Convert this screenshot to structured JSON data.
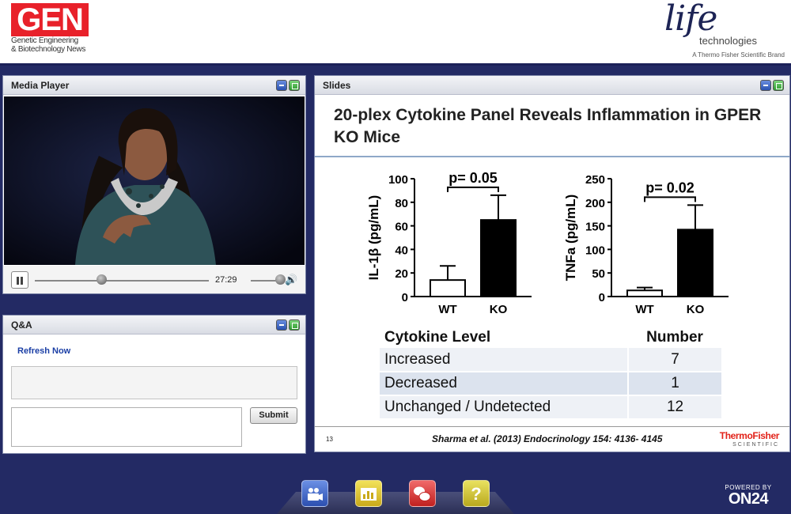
{
  "header": {
    "gen_logo": {
      "wordmark": "GEN",
      "line1": "Genetic Engineering",
      "line2": "& Biotechnology News"
    },
    "life_logo": {
      "wordmark": "life",
      "subtitle": "technologies",
      "tagline": "A Thermo Fisher Scientific Brand"
    }
  },
  "media_player": {
    "title": "Media Player",
    "time": "27:29",
    "progress_fraction": 0.38,
    "volume_fraction": 0.85,
    "icons": [
      "pause-icon",
      "speaker-icon",
      "minimize-icon",
      "maximize-icon"
    ]
  },
  "qa": {
    "title": "Q&A",
    "refresh_label": "Refresh Now",
    "input_value": "",
    "submit_label": "Submit"
  },
  "slides": {
    "title": "Slides",
    "slide_title": "20-plex Cytokine Panel Reveals Inflammation in GPER KO Mice",
    "table": {
      "headers": [
        "Cytokine Level",
        "Number"
      ],
      "rows": [
        {
          "label": "Increased",
          "value": "7"
        },
        {
          "label": "Decreased",
          "value": "1"
        },
        {
          "label": "Unchanged / Undetected",
          "value": "12"
        }
      ]
    },
    "footer": {
      "slide_number": "13",
      "citation": "Sharma et al. (2013) Endocrinology  154: 4136- 4145",
      "logo_name": "ThermoFisher",
      "logo_sub": "SCIENTIFIC"
    }
  },
  "chart_data": [
    {
      "type": "bar",
      "categories": [
        "WT",
        "KO"
      ],
      "values": [
        14,
        65
      ],
      "errors": [
        12,
        21
      ],
      "ylabel": "IL-1β (pg/mL)",
      "ylim": [
        0,
        100
      ],
      "yticks": [
        0,
        20,
        40,
        60,
        80,
        100
      ],
      "annotation": "p= 0.05",
      "colors": [
        "#ffffff",
        "#000000"
      ]
    },
    {
      "type": "bar",
      "categories": [
        "WT",
        "KO"
      ],
      "values": [
        13,
        142
      ],
      "errors": [
        6,
        52
      ],
      "ylabel": "TNFa (pg/mL)",
      "ylim": [
        0,
        250
      ],
      "yticks": [
        0,
        50,
        100,
        150,
        200,
        250
      ],
      "annotation": "p= 0.02",
      "colors": [
        "#ffffff",
        "#000000"
      ]
    }
  ],
  "dock": {
    "items": [
      {
        "name": "speaker-bio",
        "icon": "speaker-icon",
        "color": "#3a5fc4"
      },
      {
        "name": "slides",
        "icon": "chart-icon",
        "color": "#e3cc35"
      },
      {
        "name": "qa",
        "icon": "chat-icon",
        "color": "#d83434"
      },
      {
        "name": "help",
        "icon": "question-icon",
        "color": "#d7cb3b",
        "glyph": "?"
      }
    ]
  },
  "powered_by": {
    "label": "POWERED BY",
    "brand": "ON24"
  }
}
